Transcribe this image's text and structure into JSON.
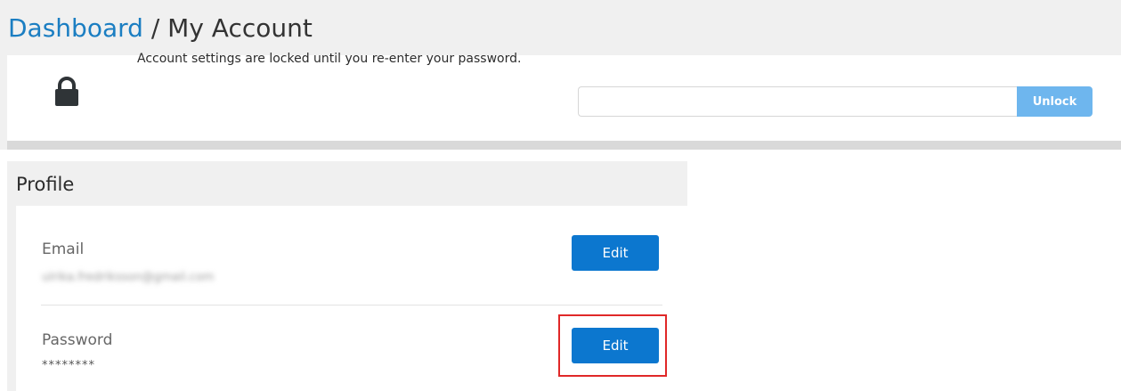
{
  "breadcrumb": {
    "parent": "Dashboard",
    "separator": " / ",
    "current": "My Account"
  },
  "lock_banner": {
    "icon": "lock-icon",
    "message": "Account settings are locked until you re-enter your password.",
    "password_value": "",
    "unlock_label": "Unlock"
  },
  "profile": {
    "title": "Profile",
    "rows": [
      {
        "label": "Email",
        "value": "ulrika.fredriksson@gmail.com",
        "edit_label": "Edit"
      },
      {
        "label": "Password",
        "value": "********",
        "edit_label": "Edit"
      }
    ]
  },
  "colors": {
    "link": "#1b7ec2",
    "edit_button": "#0c77cf",
    "unlock_button": "#6eb6ee",
    "highlight": "#e02828"
  }
}
